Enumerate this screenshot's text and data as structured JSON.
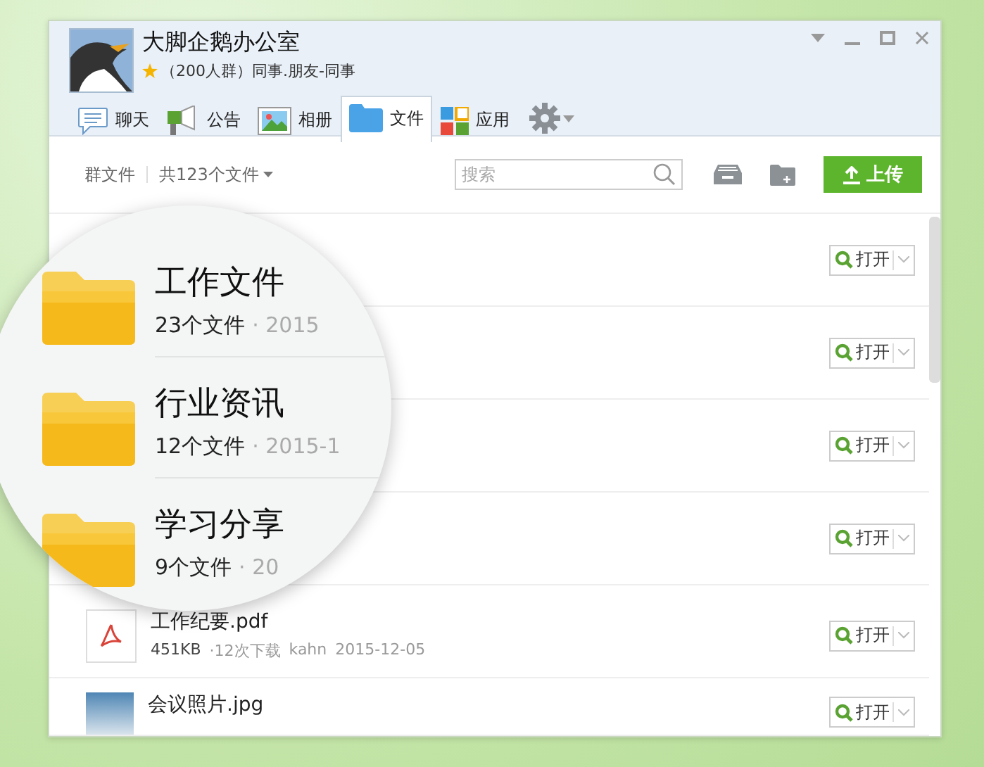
{
  "window": {
    "title": "大脚企鹅办公室",
    "subtitle": "（200人群）同事.朋友-同事"
  },
  "tabs": [
    {
      "label": "聊天",
      "kind": "chat",
      "selected": false
    },
    {
      "label": "公告",
      "kind": "notice",
      "selected": false
    },
    {
      "label": "相册",
      "kind": "album",
      "selected": false
    },
    {
      "label": "文件",
      "kind": "files",
      "selected": true
    },
    {
      "label": "应用",
      "kind": "apps",
      "selected": false
    }
  ],
  "toolbar": {
    "breadcrumb": "群文件",
    "count": "共123个文件",
    "search": {
      "placeholder": "搜索"
    },
    "upload": "上传"
  },
  "rows": [
    {
      "kind": "folder",
      "open": "打开"
    },
    {
      "kind": "folder",
      "open": "打开"
    },
    {
      "kind": "folder",
      "open": "打开"
    },
    {
      "kind": "folder",
      "open": "打开"
    },
    {
      "kind": "pdf",
      "name": "工作纪要.pdf",
      "size": "451KB",
      "downloads": "·12次下载",
      "uploader": "kahn",
      "date": "2015-12-05",
      "open": "打开"
    },
    {
      "kind": "image",
      "name": "会议照片.jpg",
      "open": "打开"
    }
  ],
  "magnifier": {
    "items": [
      {
        "name": "工作文件",
        "count": "23个文件",
        "date": "· 2015"
      },
      {
        "name": "行业资讯",
        "count": "12个文件",
        "date": "· 2015-1"
      },
      {
        "name": "学习分享",
        "count": "9个文件",
        "date": "· 20"
      }
    ]
  }
}
